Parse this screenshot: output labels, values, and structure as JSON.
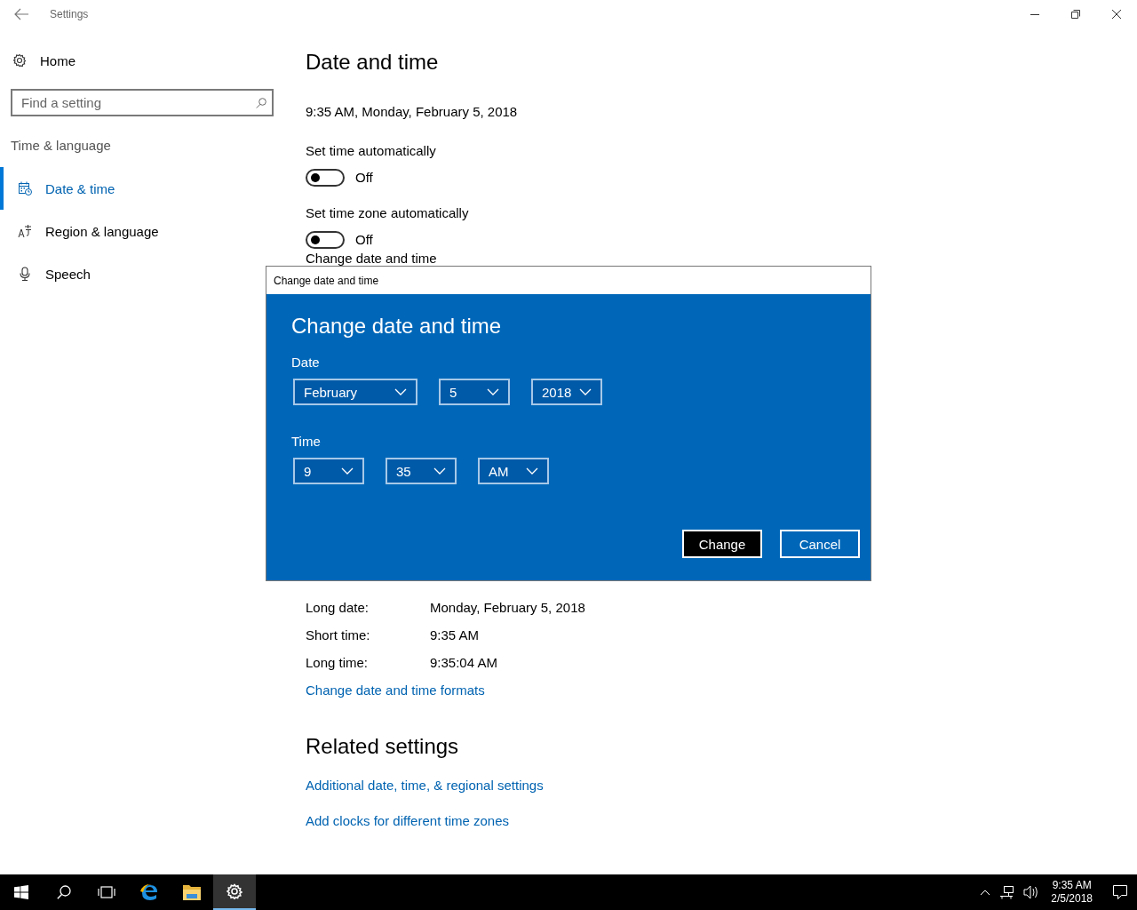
{
  "window": {
    "title": "Settings"
  },
  "sidebar": {
    "home": "Home",
    "search": {
      "placeholder": "Find a setting"
    },
    "section": "Time & language",
    "items": [
      {
        "label": "Date & time",
        "selected": true
      },
      {
        "label": "Region & language",
        "selected": false
      },
      {
        "label": "Speech",
        "selected": false
      }
    ]
  },
  "content": {
    "heading": "Date and time",
    "current": "9:35 AM, Monday, February 5, 2018",
    "toggles": [
      {
        "label": "Set time automatically",
        "on": false,
        "state_text": "Off"
      },
      {
        "label": "Set time zone automatically",
        "on": false,
        "state_text": "Off"
      }
    ],
    "change_label": "Change date and time",
    "formats": [
      {
        "label": "Long date:",
        "value": "Monday, February 5, 2018"
      },
      {
        "label": "Short time:",
        "value": "9:35 AM"
      },
      {
        "label": "Long time:",
        "value": "9:35:04 AM"
      }
    ],
    "formats_link": "Change date and time formats",
    "related": {
      "heading": "Related settings",
      "links": [
        "Additional date, time, & regional settings",
        "Add clocks for different time zones"
      ]
    }
  },
  "dialog": {
    "title": "Change date and time",
    "heading": "Change date and time",
    "date_label": "Date",
    "date_fields": [
      "February",
      "5",
      "2018"
    ],
    "time_label": "Time",
    "time_fields": [
      "9",
      "35",
      "AM"
    ],
    "buttons": [
      {
        "label": "Change",
        "focused": true
      },
      {
        "label": "Cancel",
        "focused": false
      }
    ]
  },
  "taskbar": {
    "apps": [
      {
        "selected": false
      },
      {
        "selected": false
      },
      {
        "selected": false
      },
      {
        "selected": false
      },
      {
        "selected": false
      },
      {
        "selected": true
      }
    ],
    "clock": {
      "time": "9:35 AM",
      "date": "2/5/2018"
    }
  }
}
